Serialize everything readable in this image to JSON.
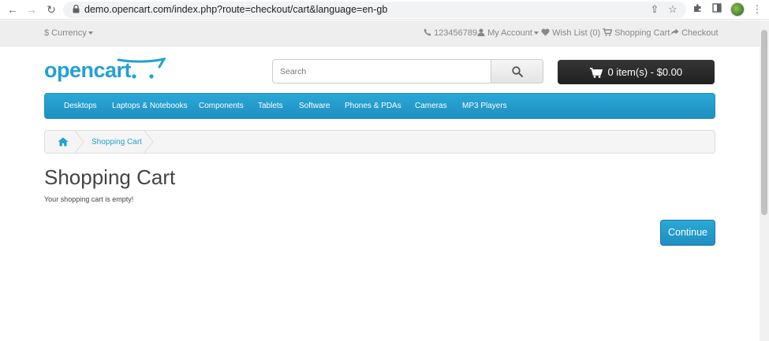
{
  "browser": {
    "url": "demo.opencart.com/index.php?route=checkout/cart&language=en-gb"
  },
  "topbar": {
    "currency": "$ Currency",
    "phone": "123456789",
    "my_account": "My Account",
    "wish_list": "Wish List (0)",
    "shopping_cart": "Shopping Cart",
    "checkout": "Checkout"
  },
  "header": {
    "logo": "opencart",
    "search_placeholder": "Search",
    "cart_summary": "0 item(s) - $0.00"
  },
  "menu": {
    "items": [
      "Desktops",
      "Laptops & Notebooks",
      "Components",
      "Tablets",
      "Software",
      "Phones & PDAs",
      "Cameras",
      "MP3 Players"
    ]
  },
  "breadcrumb": {
    "current": "Shopping Cart"
  },
  "content": {
    "title": "Shopping Cart",
    "message": "Your shopping cart is empty!",
    "continue_label": "Continue"
  },
  "colors": {
    "brand": "#23a1d1",
    "dark_button": "#222222",
    "topbar_bg": "#eeeeee"
  }
}
